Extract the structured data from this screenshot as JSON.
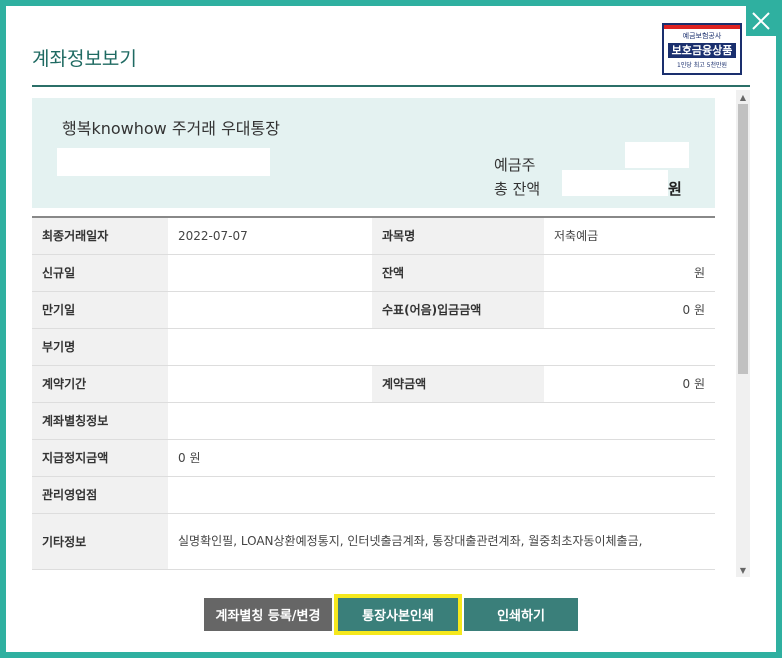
{
  "dialog": {
    "title": "계좌정보보기",
    "badge": {
      "top": "예금보험공사",
      "main": "보호금융상품",
      "sub": "1인당 최고 5천만원"
    }
  },
  "summary": {
    "account_name": "행복knowhow 주거래 우대통장",
    "depositor_label": "예금주",
    "balance_label": "총 잔액",
    "balance_unit": "원"
  },
  "table": {
    "rows": [
      {
        "l1": "최종거래일자",
        "v1": "2022-07-07",
        "l2": "과목명",
        "v2": "저축예금"
      },
      {
        "l1": "신규일",
        "v1": "",
        "l2": "잔액",
        "v2": "원"
      },
      {
        "l1": "만기일",
        "v1": "",
        "l2": "수표(어음)입금금액",
        "v2": "0 원"
      },
      {
        "l1": "부기명",
        "v1": ""
      },
      {
        "l1": "계약기간",
        "v1": "",
        "l2": "계약금액",
        "v2": "0 원"
      },
      {
        "l1": "계좌별칭정보",
        "v1": ""
      },
      {
        "l1": "지급정지금액",
        "v1": "0 원"
      },
      {
        "l1": "관리영업점",
        "v1": ""
      },
      {
        "l1": "기타정보",
        "v1": "실명확인필,  LOAN상환예정통지,  인터넷출금계좌,  통장대출관련계좌,  월중최초자동이체출금,"
      }
    ]
  },
  "buttons": {
    "alias": "계좌별칭 등록/변경",
    "print_book": "통장사본인쇄",
    "print": "인쇄하기"
  },
  "colors": {
    "border": "#2fb0a0",
    "primary": "#3a7f7a",
    "highlight": "#f5e81d"
  }
}
